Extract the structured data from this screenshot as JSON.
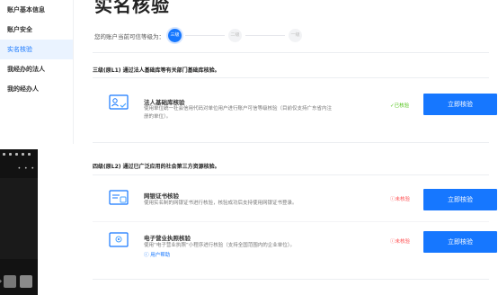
{
  "sidebar": {
    "items": [
      {
        "label": "账户基本信息",
        "active": false
      },
      {
        "label": "账户安全",
        "active": false
      },
      {
        "label": "实名核验",
        "active": true
      },
      {
        "label": "我经办的法人",
        "active": false
      },
      {
        "label": "我的经办人",
        "active": false
      }
    ]
  },
  "page": {
    "title": "实名核验",
    "trust_text": "您的账户当前可信等级为：",
    "steps": [
      "三级",
      "二级",
      "一级"
    ]
  },
  "level3": {
    "heading": "三级(原L1) 通过法人基础库等有关部门基础库核验。",
    "cards": [
      {
        "title": "法人基础库核验",
        "desc": "使用单位统一社会信用代码对单位用户进行账户可信等级核验（目前仅支持广东省内注册的单位）。",
        "status": "已核验",
        "status_icon": "check-circle-icon",
        "button": "立即核验"
      }
    ]
  },
  "level2": {
    "heading": "四级(原L2) 通过已广泛应用的社会第三方资源核验。",
    "cards": [
      {
        "title": "网银证书核验",
        "desc": "使用实名制的网银证书进行核验，核验成功后支持使用网银证书登录。",
        "status": "未核验",
        "status_icon": "exclamation-circle-icon",
        "button": "立即核验"
      },
      {
        "title": "电子营业执照核验",
        "desc": "使用“电子营业执照”小程序进行核验（支持全国范围内的企业单位）。",
        "help": "用户帮助",
        "status": "未核验",
        "status_icon": "exclamation-circle-icon",
        "button": "立即核验"
      }
    ]
  },
  "colors": {
    "accent": "#1677ff",
    "verified": "#52c41a",
    "unverified": "#ff4d4f"
  }
}
